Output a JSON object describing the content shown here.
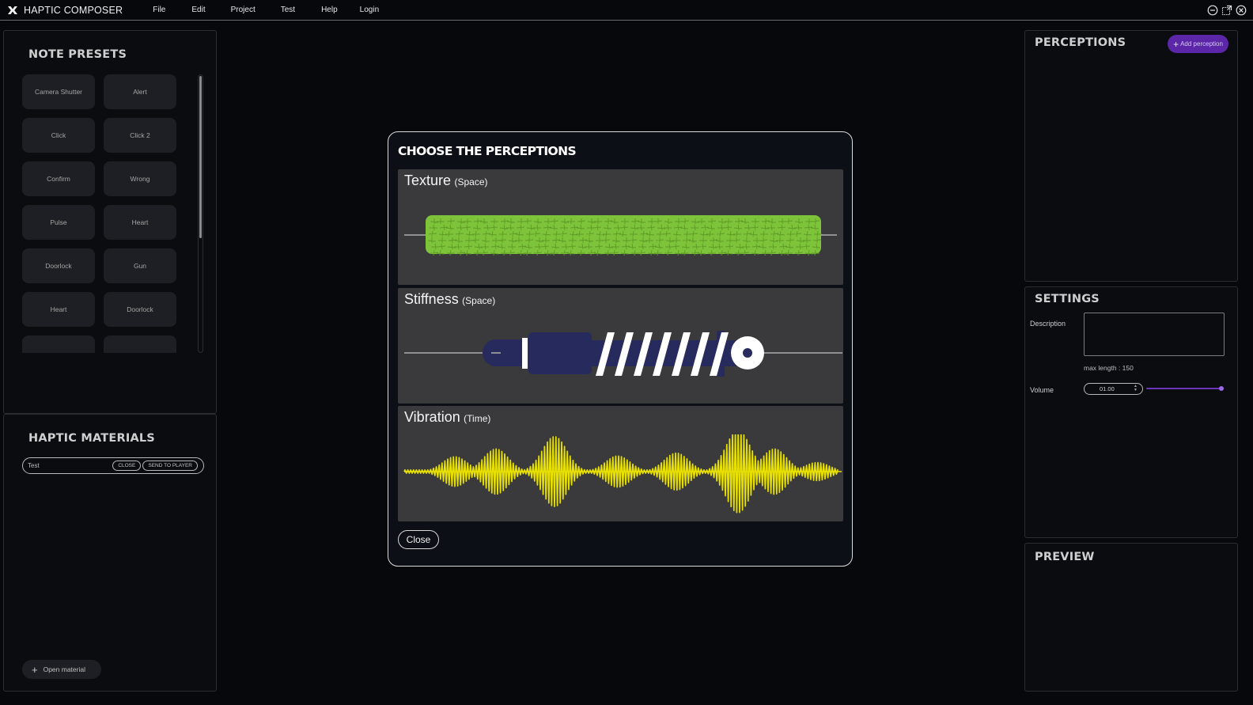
{
  "app": {
    "title": "HAPTIC COMPOSER",
    "logo_icon": "haptic-composer-logo-icon"
  },
  "menu": {
    "items": [
      {
        "id": "file",
        "label": "File"
      },
      {
        "id": "edit",
        "label": "Edit"
      },
      {
        "id": "project",
        "label": "Project"
      },
      {
        "id": "test",
        "label": "Test"
      },
      {
        "id": "help",
        "label": "Help"
      },
      {
        "id": "login",
        "label": "Login"
      }
    ],
    "window_controls": [
      "minimize-icon",
      "maximize-icon",
      "close-icon"
    ]
  },
  "note_presets": {
    "title": "NOTE PRESETS",
    "items": [
      "Camera Shutter",
      "Alert",
      "Click",
      "Click 2",
      "Confirm",
      "Wrong",
      "Pulse",
      "Heart",
      "Doorlock",
      "Gun",
      "Heart",
      "Doorlock",
      "",
      ""
    ]
  },
  "haptic_materials": {
    "title": "HAPTIC MATERIALS",
    "material": {
      "name": "Test",
      "close_label": "CLOSE",
      "send_label": "SEND TO PLAYER"
    },
    "open_material_label": "Open material"
  },
  "perceptions": {
    "title": "PERCEPTIONS",
    "add_label": "Add perception"
  },
  "settings": {
    "title": "SETTINGS",
    "description_label": "Description",
    "description_value": "",
    "max_length_note": "max length : 150",
    "volume_label": "Volume",
    "volume_value": "01.00",
    "volume_level_fraction": 1.0
  },
  "preview": {
    "title": "PREVIEW"
  },
  "modal": {
    "title": "CHOOSE THE PERCEPTIONS",
    "cards": [
      {
        "id": "texture",
        "name": "Texture",
        "qualifier": "(Space)",
        "color": "#7dc43a"
      },
      {
        "id": "stiffness",
        "name": "Stiffness",
        "qualifier": "(Space)",
        "color": "#272a5c"
      },
      {
        "id": "vibration",
        "name": "Vibration",
        "qualifier": "(Time)",
        "color": "#e8e000"
      }
    ],
    "close_label": "Close"
  },
  "colors": {
    "accent": "#5b27a8",
    "background": "#07080c",
    "card": "#3a3a3c"
  }
}
